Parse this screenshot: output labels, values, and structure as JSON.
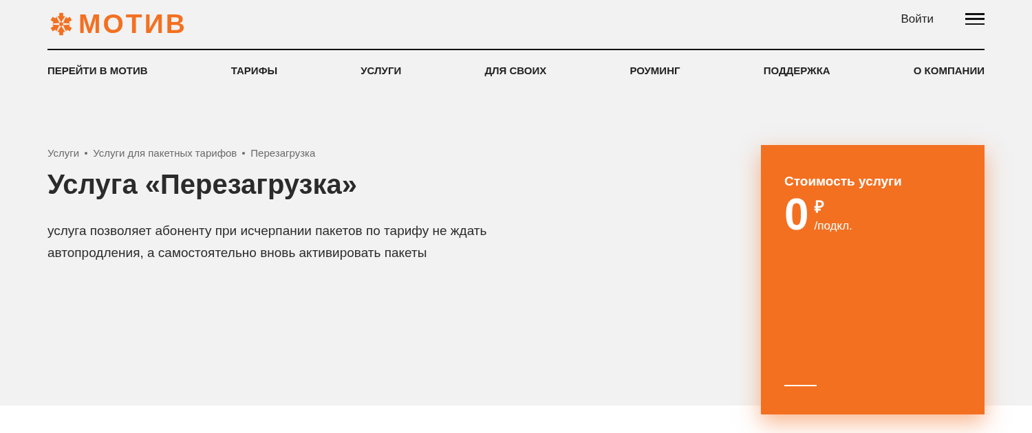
{
  "header": {
    "logo": {
      "text": "МОТИВ"
    },
    "login": "Войти"
  },
  "nav": [
    {
      "label": "ПЕРЕЙТИ В МОТИВ"
    },
    {
      "label": "ТАРИФЫ"
    },
    {
      "label": "УСЛУГИ"
    },
    {
      "label": "ДЛЯ СВОИХ"
    },
    {
      "label": "РОУМИНГ"
    },
    {
      "label": "ПОДДЕРЖКА"
    },
    {
      "label": "О КОМПАНИИ"
    }
  ],
  "breadcrumbs": [
    {
      "label": "Услуги"
    },
    {
      "label": "Услуги для пакетных тарифов"
    },
    {
      "label": "Перезагрузка"
    }
  ],
  "title": "Услуга «Перезагрузка»",
  "description": "услуга позволяет абоненту при исчерпании пакетов по тарифу не ждать автопродления, а самостоятельно вновь активировать пакеты",
  "price_card": {
    "heading": "Стоимость услуги",
    "amount": "0",
    "currency": "₽",
    "unit": "/подкл."
  }
}
